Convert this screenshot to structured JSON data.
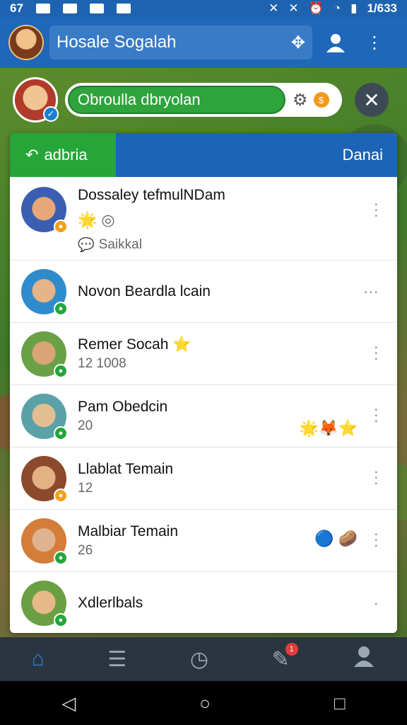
{
  "status": {
    "time_left": "67",
    "time_right": "1/633"
  },
  "appbar": {
    "title": "Hosale Sogalah"
  },
  "search": {
    "value": "Obroulla dbryolan",
    "coin_label": "$"
  },
  "tabs": {
    "active_label": "adbria",
    "right_label": "Danai"
  },
  "list": [
    {
      "name": "Dossaley tefmulNDam",
      "sub": "",
      "tagline": "Saikkal",
      "dot": "orange",
      "av_skin": "#e8a77a",
      "av_bg": "#3b5fb0"
    },
    {
      "name": "Novon Beardla lcain",
      "sub": "",
      "dot": "green",
      "av_skin": "#e5b489",
      "av_bg": "#2f8ccc"
    },
    {
      "name": "Remer Socah",
      "sub": "12 1008",
      "dot": "green",
      "av_skin": "#d9a577",
      "av_bg": "#6aa046"
    },
    {
      "name": "Pam Obedcin",
      "sub": "20",
      "dot": "green",
      "av_skin": "#e2bf93",
      "av_bg": "#5aa1a8"
    },
    {
      "name": "Llablat Temain",
      "sub": "12",
      "dot": "orange",
      "av_skin": "#e3b184",
      "av_bg": "#8a4a2b"
    },
    {
      "name": "Malbiar Temain",
      "sub": "26",
      "dot": "green",
      "av_skin": "#dfb391",
      "av_bg": "#d47c3a"
    },
    {
      "name": "Xdlerlbals",
      "sub": "",
      "dot": "green",
      "av_skin": "#e7b98a",
      "av_bg": "#6aa043"
    }
  ],
  "nav": {
    "notif_count": "1"
  }
}
